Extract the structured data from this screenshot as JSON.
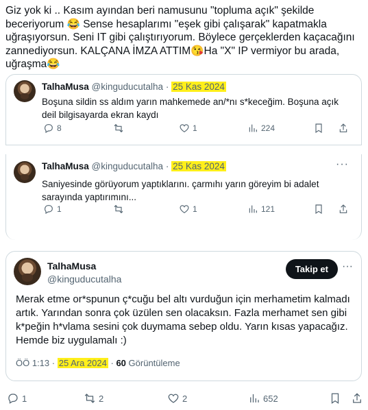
{
  "post": {
    "text": "Giz yok ki .. Kasım ayından beri namusunu \"topluma açık\" şekilde beceriyorum 😂 Sense hesaplarımı \"eşek gibi çalışarak\" kapatmakla uğraşıyorsun. Seni IT gibi çalıştırıyorum. Böylece gerçeklerden kaçacağını zannediyorsun. KALÇANA İMZA ATTIM😘Ha \"X\" IP vermiyor bu arada, uğraşma😂"
  },
  "quoted_1": {
    "name": "TalhaMusa",
    "handle": "@kinguducutalha",
    "dot": "·",
    "date": "25 Kas 2024",
    "text": "Boşuna sildin ss aldım yarın mahkemede an/*nı s*keceğim. Boşuna açık deil bilgisayarda ekran kaydı",
    "replies": "8",
    "retweets": "",
    "likes": "1",
    "views": "224",
    "more": "···"
  },
  "quoted_2": {
    "name": "TalhaMusa",
    "handle": "@kinguducutalha",
    "dot": "·",
    "date": "25 Kas 2024",
    "text": "Saniyesinde görüyorum yaptıklarını. çarmıhı yarın göreyim bi adalet sarayında yaptırımını...",
    "replies": "1",
    "retweets": "",
    "likes": "1",
    "views": "121",
    "more": "···"
  },
  "main_tweet": {
    "name": "TalhaMusa",
    "handle": "@kinguducutalha",
    "follow_label": "Takip et",
    "more": "···",
    "text": "Merak etme or*spunun ç*cuğu bel altı vurduğun için merhametim kalmadı artık. Yarından sonra çok üzülen sen olacaksın. Fazla merhamet sen gibi k*peğin h*vlama sesini çok duymama sebep oldu. Yarın kısas yapacağız. Hemde biz uygulamalı :)",
    "time": "ÖÖ 1:13",
    "dot": "·",
    "date": "25 Ara 2024",
    "views_count": "60",
    "views_label": "Görüntüleme"
  },
  "bottom_actions": {
    "replies": "1",
    "retweets": "2",
    "likes": "2",
    "views": "652"
  }
}
